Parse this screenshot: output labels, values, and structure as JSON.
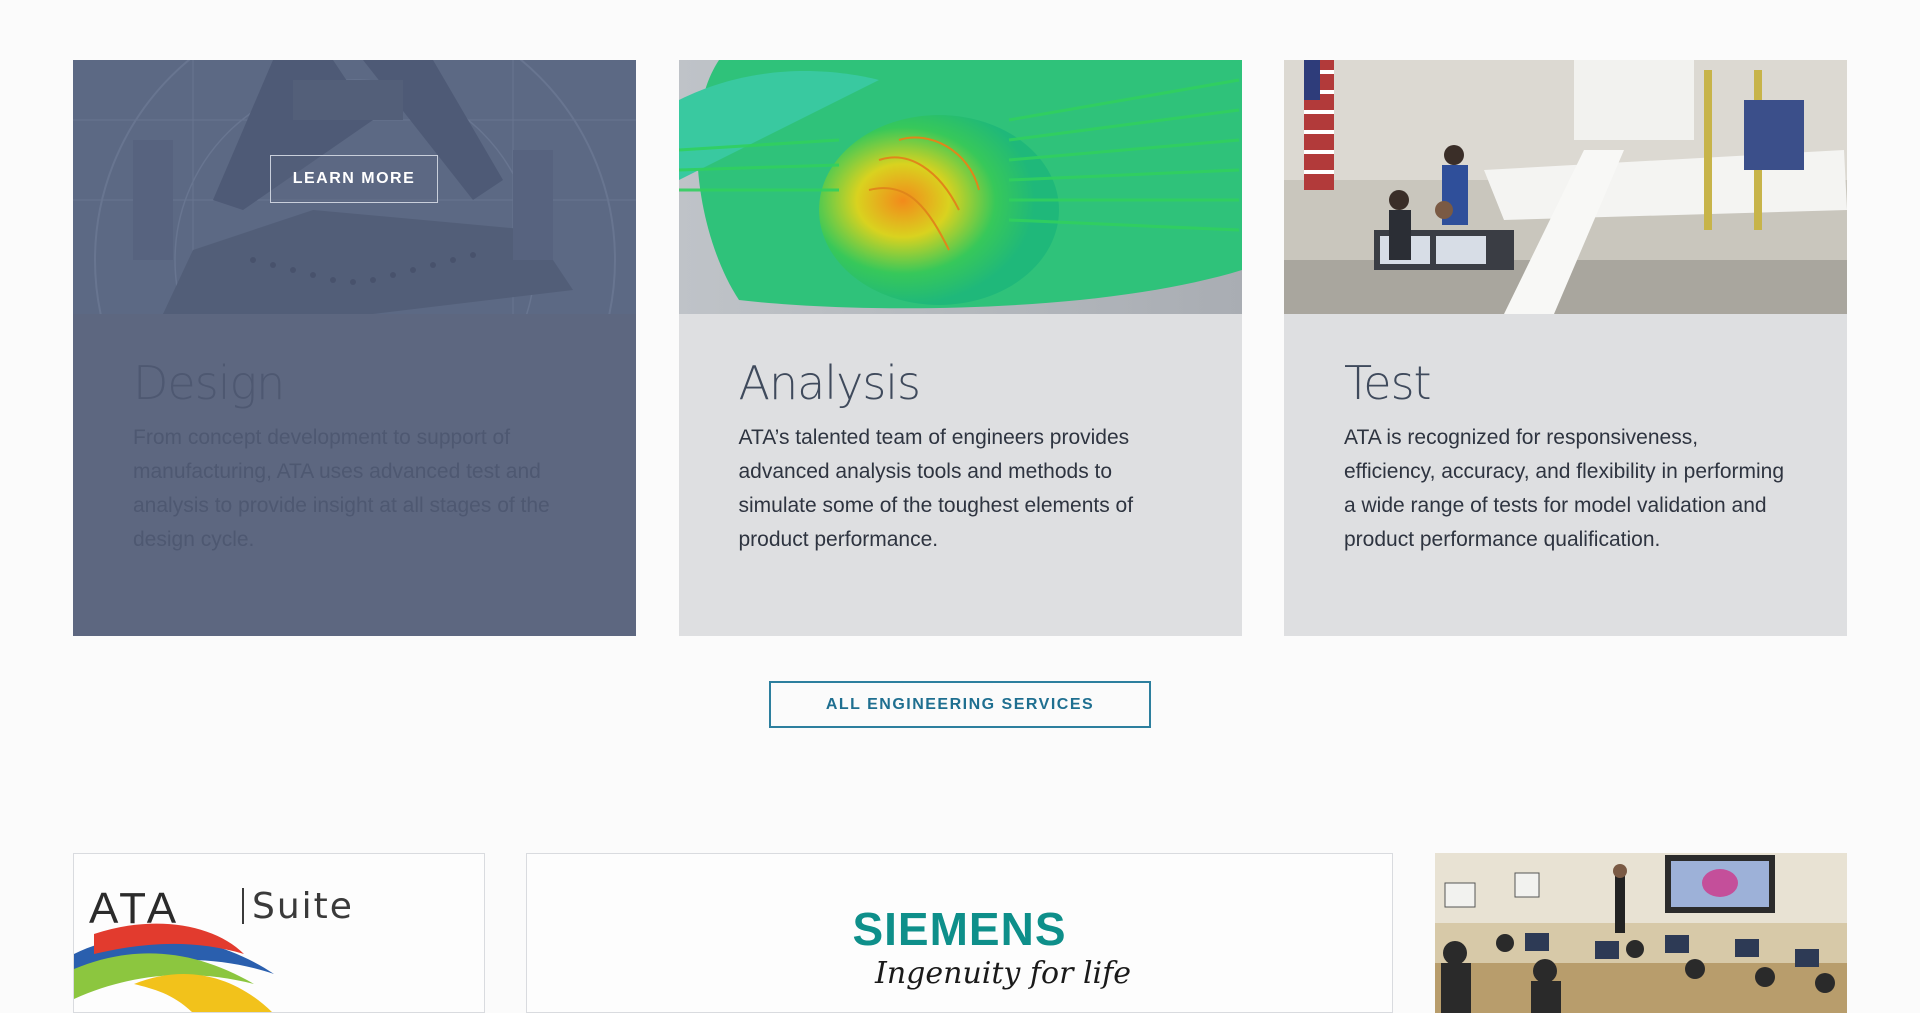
{
  "services": {
    "cards": [
      {
        "id": "design",
        "title": "Design",
        "text": "From concept development to support of manufacturing, ATA uses advanced test and analysis to provide insight at all stages of the design cycle.",
        "cta_label": "LEARN MORE",
        "image_icon": "mechanical-design-icon",
        "active": true
      },
      {
        "id": "analysis",
        "title": "Analysis",
        "text": "ATA’s talented team of engineers provides advanced analysis tools and methods to simulate some of the toughest elements of product performance.",
        "image_icon": "simulation-icon",
        "active": false
      },
      {
        "id": "test",
        "title": "Test",
        "text": "ATA is recognized for responsiveness, efficiency, accuracy, and flexibility in performing a wide range of tests for model validation and product performance qualification.",
        "image_icon": "test-lab-icon",
        "active": false
      }
    ],
    "all_services_label": "ALL ENGINEERING SERVICES"
  },
  "partners": {
    "ata_suite": {
      "logo_text": "ATA",
      "suite_text": "Suite"
    },
    "siemens": {
      "name": "SIEMENS",
      "tagline": "Ingenuity for life"
    },
    "training": {
      "image_icon": "training-classroom-icon"
    }
  },
  "colors": {
    "active_card": "#5d6780",
    "card": "#dedfe1",
    "accent": "#1f6f90",
    "siemens": "#0e8f8a"
  }
}
